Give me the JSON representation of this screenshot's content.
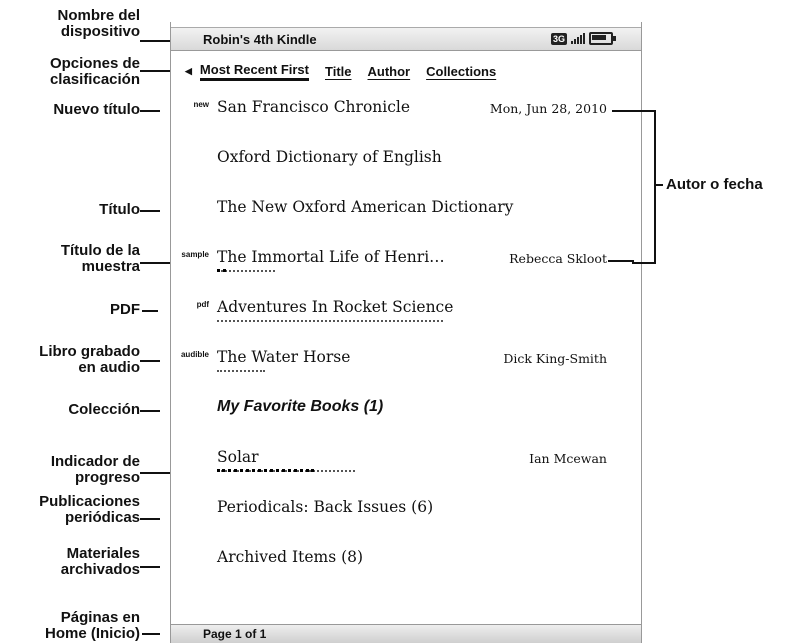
{
  "device": {
    "name": "Robin's 4th Kindle",
    "network": "3G",
    "battery_icon": "battery-icon",
    "signal_icon": "signal-bars-icon"
  },
  "sort": {
    "arrow_icon": "left-triangle-icon",
    "options": [
      "Most Recent First",
      "Title",
      "Author",
      "Collections"
    ],
    "active": "Most Recent First"
  },
  "items": [
    {
      "tag": "new",
      "title": "San Francisco Chronicle",
      "meta": "Mon, Jun 28, 2010",
      "italic": false
    },
    {
      "tag": "",
      "title": "Oxford Dictionary of English",
      "meta": "",
      "italic": false
    },
    {
      "tag": "",
      "title": "The New Oxford American Dictionary",
      "meta": "",
      "italic": false
    },
    {
      "tag": "sample",
      "title": "The Immortal Life of Henri…",
      "meta": "Rebecca Skloot",
      "italic": false,
      "progress": 0.15
    },
    {
      "tag": "pdf",
      "title": "Adventures In Rocket Science",
      "meta": "",
      "italic": false,
      "progress": 0.0
    },
    {
      "tag": "audible",
      "title": "The Water Horse",
      "meta": "Dick King-Smith",
      "italic": false,
      "progress": 0.0
    },
    {
      "tag": "",
      "title": "My Favorite Books (1)",
      "meta": "",
      "italic": true
    },
    {
      "tag": "",
      "title": "Solar",
      "meta": "Ian Mcewan",
      "italic": false,
      "progress": 0.7
    },
    {
      "tag": "",
      "title": "Periodicals: Back Issues (6)",
      "meta": "",
      "italic": false
    },
    {
      "tag": "",
      "title": "Archived Items (8)",
      "meta": "",
      "italic": false
    }
  ],
  "footer": {
    "page": "Page 1 of 1"
  },
  "callouts": {
    "device_name": [
      "Nombre del",
      "dispositivo"
    ],
    "sort_options": [
      "Opciones de",
      "clasificación"
    ],
    "new_title": [
      "Nuevo título"
    ],
    "title": [
      "Título"
    ],
    "sample_title": [
      "Título de la",
      "muestra"
    ],
    "pdf": [
      "PDF"
    ],
    "audio_book": [
      "Libro grabado",
      "en audio"
    ],
    "collection": [
      "Colección"
    ],
    "progress": [
      "Indicador de",
      "progreso"
    ],
    "periodicals": [
      "Publicaciones",
      "periódicas"
    ],
    "archived": [
      "Materiales",
      "archivados"
    ],
    "home_pages": [
      "Páginas en",
      "Home (Inicio)"
    ],
    "author_or_date": "Autor o fecha"
  }
}
